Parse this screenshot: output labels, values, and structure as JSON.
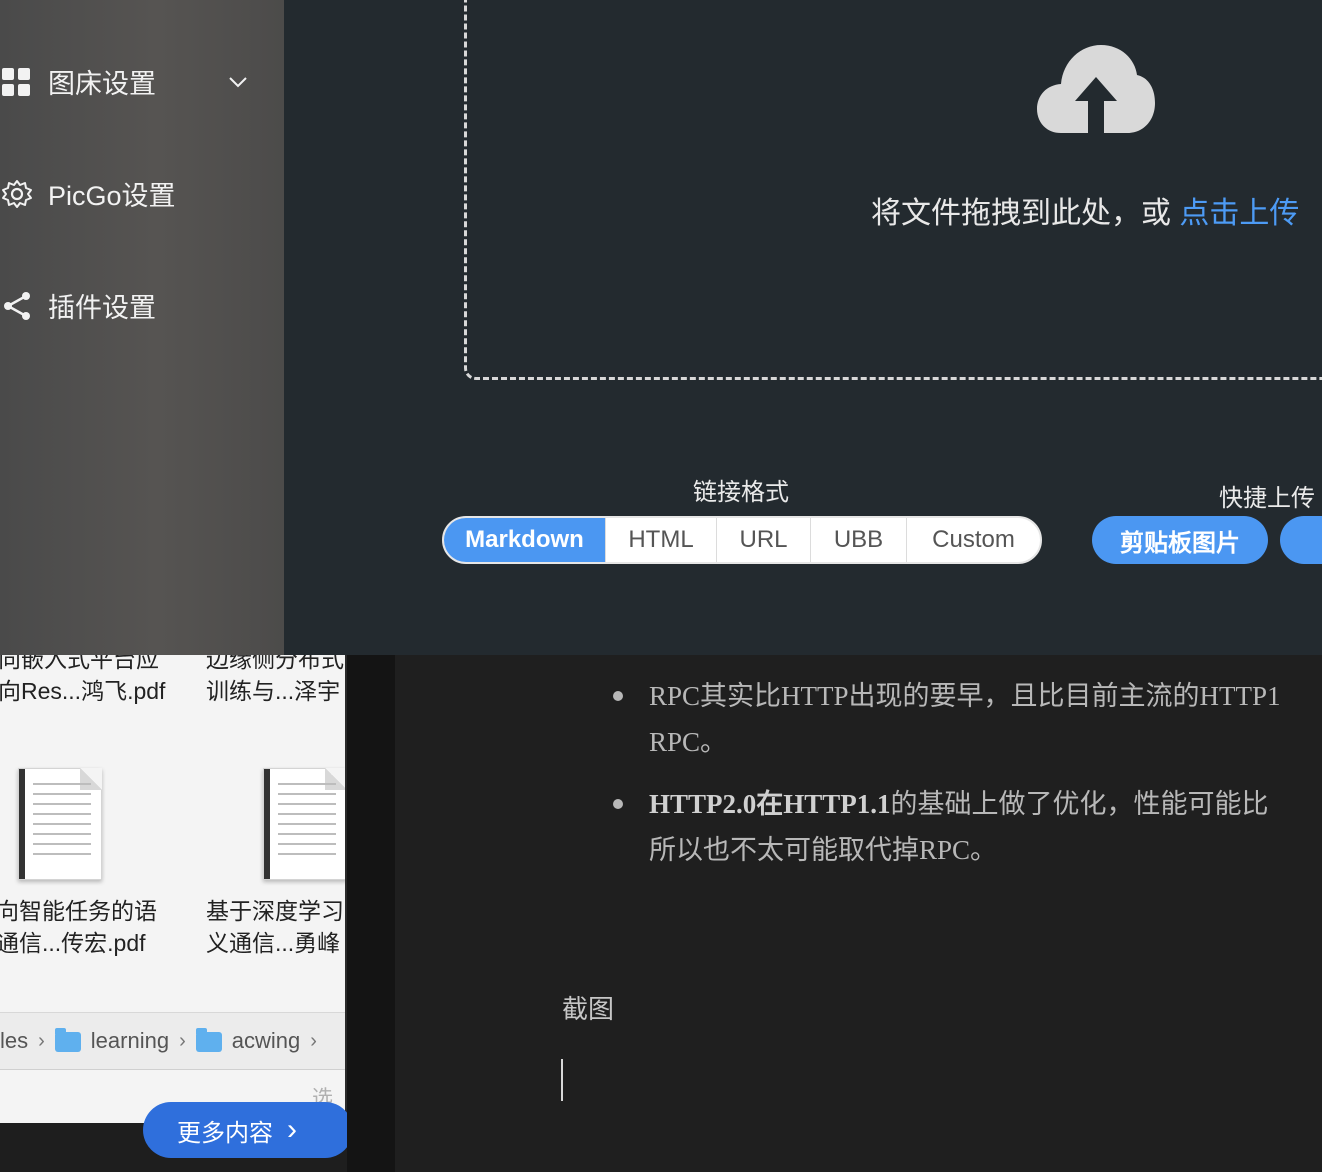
{
  "sidebar": {
    "items": [
      {
        "label": "图床设置",
        "icon": "grid-icon"
      },
      {
        "label": "PicGo设置",
        "icon": "gear-icon"
      },
      {
        "label": "插件设置",
        "icon": "share-icon"
      }
    ]
  },
  "upload": {
    "drop_text": "将文件拖拽到此处，或",
    "click_link": "点击上传"
  },
  "link_format": {
    "label": "链接格式",
    "options": [
      "Markdown",
      "HTML",
      "URL",
      "UBB",
      "Custom"
    ],
    "selected": "Markdown"
  },
  "quick_upload": {
    "label": "快捷上传",
    "clipboard_button": "剪贴板图片"
  },
  "finder": {
    "files": [
      {
        "line1": "向嵌入式平台应",
        "line2": "向Res...鸿飞.pdf"
      },
      {
        "line1": "边缘侧分布式",
        "line2": "训练与...泽宇"
      },
      {
        "line1": "向智能任务的语",
        "line2": "通信...传宏.pdf"
      },
      {
        "line1": "基于深度学习",
        "line2": "义通信...勇峰"
      }
    ],
    "path": [
      "les",
      "learning",
      "acwing"
    ],
    "select_text": "选择",
    "more_button": "更多内容"
  },
  "editor": {
    "bullets": [
      {
        "line1": "RPC其实比HTTP出现的要早，且比目前主流的HTTP1",
        "line2": "RPC。"
      },
      {
        "line1_bold": "HTTP2.0在HTTP1.1",
        "line1_rest": "的基础上做了优化，性能可能比",
        "line2": "所以也不太可能取代掉RPC。"
      }
    ],
    "paragraph": "截图"
  },
  "colors": {
    "accent": "#4b97f2",
    "link": "#4d9bf5",
    "window_bg": "#232a2f",
    "editor_bg": "#1f1f1f"
  }
}
